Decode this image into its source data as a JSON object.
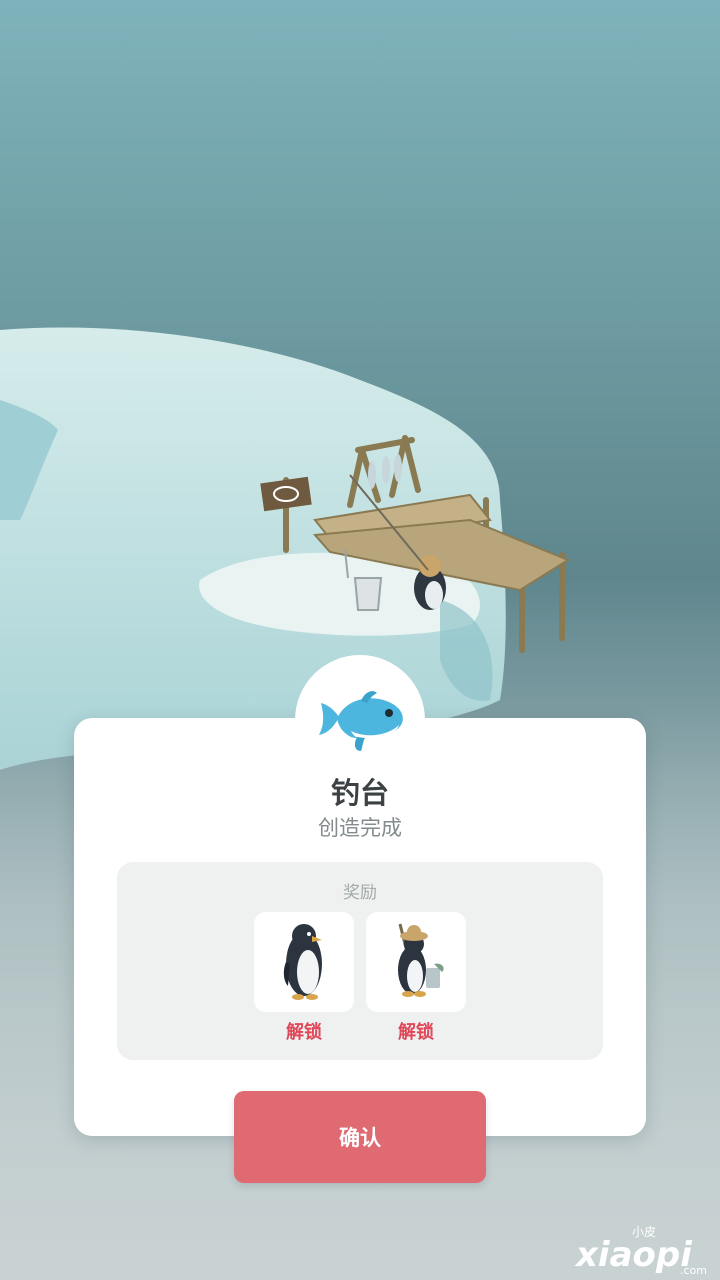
{
  "dialog": {
    "title": "钓台",
    "subtitle": "创造完成",
    "badge_icon": "fish-icon",
    "rewards_label": "奖励",
    "rewards": [
      {
        "icon": "penguin-icon",
        "caption": "解锁"
      },
      {
        "icon": "fishing-penguin-icon",
        "caption": "解锁"
      }
    ],
    "confirm_label": "确认"
  },
  "watermark": {
    "small_text": "小皮",
    "big_text": "xiaopi",
    "domain_text": ".com"
  },
  "colors": {
    "confirm_button": "#e06a72",
    "reward_caption": "#e0485a",
    "title_text": "#3c4244",
    "reward_panel": "#eef1ef"
  }
}
